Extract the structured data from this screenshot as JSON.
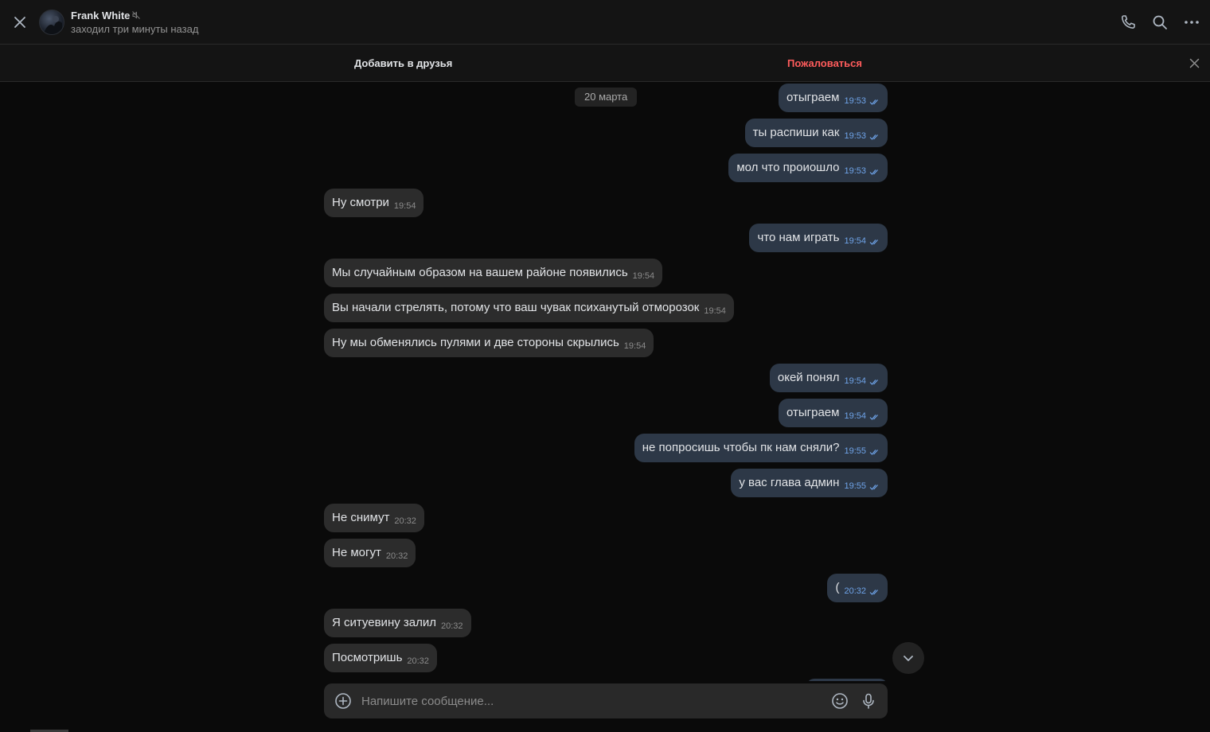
{
  "header": {
    "name": "Frank White",
    "status": "заходил три минуты назад"
  },
  "actionbar": {
    "add_friend": "Добавить в друзья",
    "report": "Пожаловаться"
  },
  "chat": {
    "date": "20 марта",
    "messages": [
      {
        "dir": "out",
        "text": "отыграем",
        "time": "19:53"
      },
      {
        "dir": "out",
        "text": "ты распиши как",
        "time": "19:53"
      },
      {
        "dir": "out",
        "text": "мол что проиошло",
        "time": "19:53"
      },
      {
        "dir": "in",
        "text": "Ну смотри",
        "time": "19:54"
      },
      {
        "dir": "out",
        "text": "что нам играть",
        "time": "19:54"
      },
      {
        "dir": "in",
        "text": "Мы случайным образом на вашем районе появились",
        "time": "19:54"
      },
      {
        "dir": "in",
        "text": "Вы начали стрелять, потому что ваш чувак психанутый отморозок",
        "time": "19:54"
      },
      {
        "dir": "in",
        "text": "Ну мы обменялись пулями и две стороны скрылись",
        "time": "19:54"
      },
      {
        "dir": "out",
        "text": "окей понял",
        "time": "19:54"
      },
      {
        "dir": "out",
        "text": "отыграем",
        "time": "19:54"
      },
      {
        "dir": "out",
        "text": "не попросишь чтобы пк нам сняли?",
        "time": "19:55"
      },
      {
        "dir": "out",
        "text": "у вас глава админ",
        "time": "19:55"
      },
      {
        "dir": "in",
        "text": "Не снимут",
        "time": "20:32"
      },
      {
        "dir": "in",
        "text": "Не могут",
        "time": "20:32"
      },
      {
        "dir": "out",
        "text": "(",
        "time": "20:32"
      },
      {
        "dir": "in",
        "text": "Я ситуевину залил",
        "time": "20:32"
      },
      {
        "dir": "in",
        "text": "Посмотришь",
        "time": "20:32"
      }
    ]
  },
  "composer": {
    "placeholder": "Напишите сообщение..."
  },
  "colors": {
    "incoming_bubble": "#2c2c2c",
    "outgoing_bubble": "#2d3847",
    "read_time": "#6ea3e8",
    "report": "#ff5c5c"
  }
}
